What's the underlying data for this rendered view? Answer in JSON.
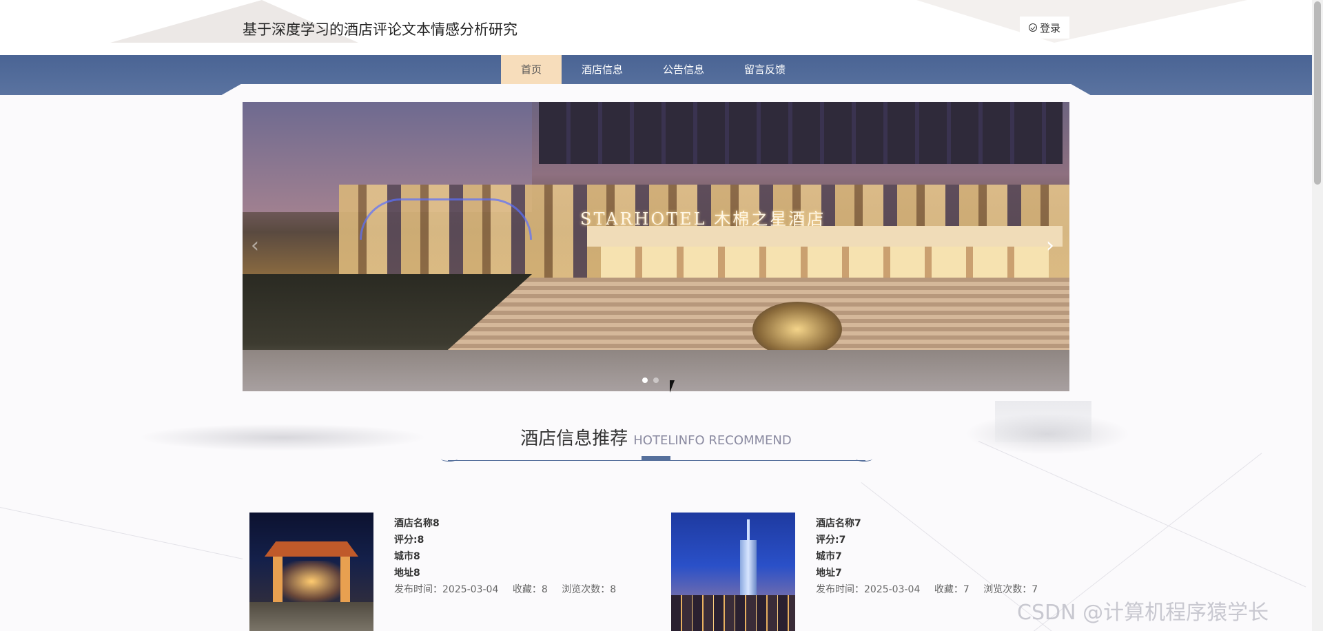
{
  "header": {
    "site_title": "基于深度学习的酒店评论文本情感分析研究",
    "login_label": "登录"
  },
  "nav": {
    "items": [
      {
        "label": "首页",
        "active": true
      },
      {
        "label": "酒店信息"
      },
      {
        "label": "公告信息"
      },
      {
        "label": "留言反馈"
      }
    ]
  },
  "banner": {
    "sign_text": "STARHOTEL 木棉之星酒店",
    "slide_count": 2,
    "active_slide": 1
  },
  "section": {
    "title_cn": "酒店信息推荐",
    "title_en": "HOTELINFO RECOMMEND"
  },
  "hotels": [
    {
      "name": "酒店名称8",
      "rating": "评分:8",
      "city": "城市8",
      "address": "地址8",
      "published": "发布时间：2025-03-04",
      "favorites": "收藏：8",
      "views": "浏览次数：8"
    },
    {
      "name": "酒店名称7",
      "rating": "评分:7",
      "city": "城市7",
      "address": "地址7",
      "published": "发布时间：2025-03-04",
      "favorites": "收藏：7",
      "views": "浏览次数：7"
    }
  ],
  "watermark": "CSDN @计算机程序猿学长",
  "colors": {
    "nav_bg": "#4a6494",
    "nav_active": "#f7ddbb",
    "accent": "#56709c"
  }
}
